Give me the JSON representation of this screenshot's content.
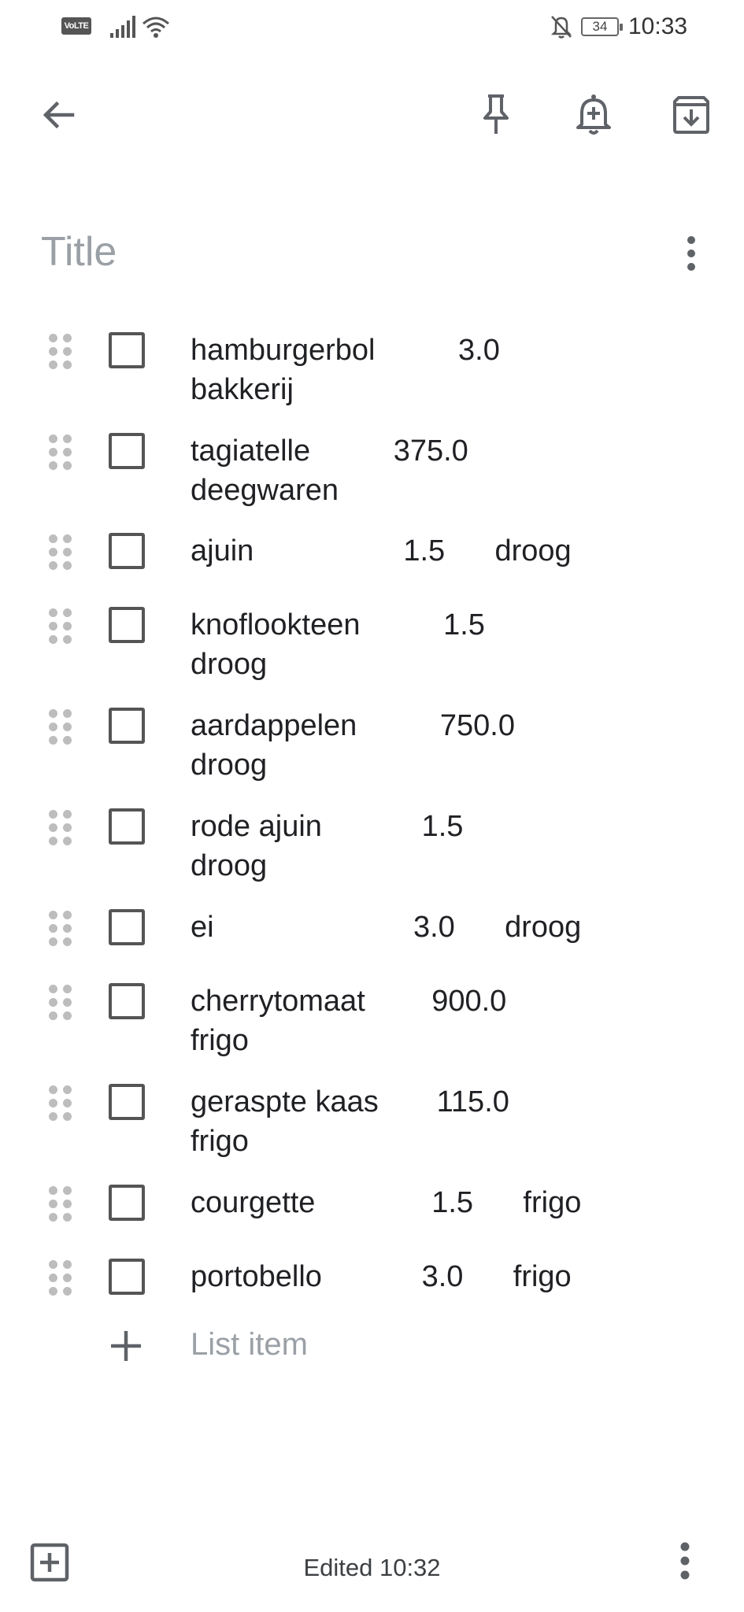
{
  "status_bar": {
    "volte": "VoLTE",
    "battery": "34",
    "time": "10:33"
  },
  "toolbar": {
    "back_icon": "arrow-back-icon",
    "pin_icon": "pin-icon",
    "reminder_icon": "add-alert-icon",
    "archive_icon": "archive-icon"
  },
  "note": {
    "title_placeholder": "Title",
    "title_value": "",
    "items": [
      {
        "text": "hamburgerbol          3.0\nbakkerij",
        "checked": false
      },
      {
        "text": "tagiatelle          375.0\ndeegwaren",
        "checked": false
      },
      {
        "text": "ajuin                  1.5      droog",
        "checked": false
      },
      {
        "text": "knoflookteen          1.5\ndroog",
        "checked": false
      },
      {
        "text": "aardappelen          750.0\ndroog",
        "checked": false
      },
      {
        "text": "rode ajuin            1.5\ndroog",
        "checked": false
      },
      {
        "text": "ei                        3.0      droog",
        "checked": false
      },
      {
        "text": "cherrytomaat        900.0\nfrigo",
        "checked": false
      },
      {
        "text": "geraspte kaas       115.0\nfrigo",
        "checked": false
      },
      {
        "text": "courgette              1.5      frigo",
        "checked": false
      },
      {
        "text": "portobello            3.0      frigo",
        "checked": false
      }
    ],
    "add_item_label": "List item"
  },
  "bottom_bar": {
    "edited": "Edited 10:32"
  },
  "colors": {
    "icon": "#5f6368",
    "placeholder": "#9aa0a6",
    "text": "#202124"
  }
}
